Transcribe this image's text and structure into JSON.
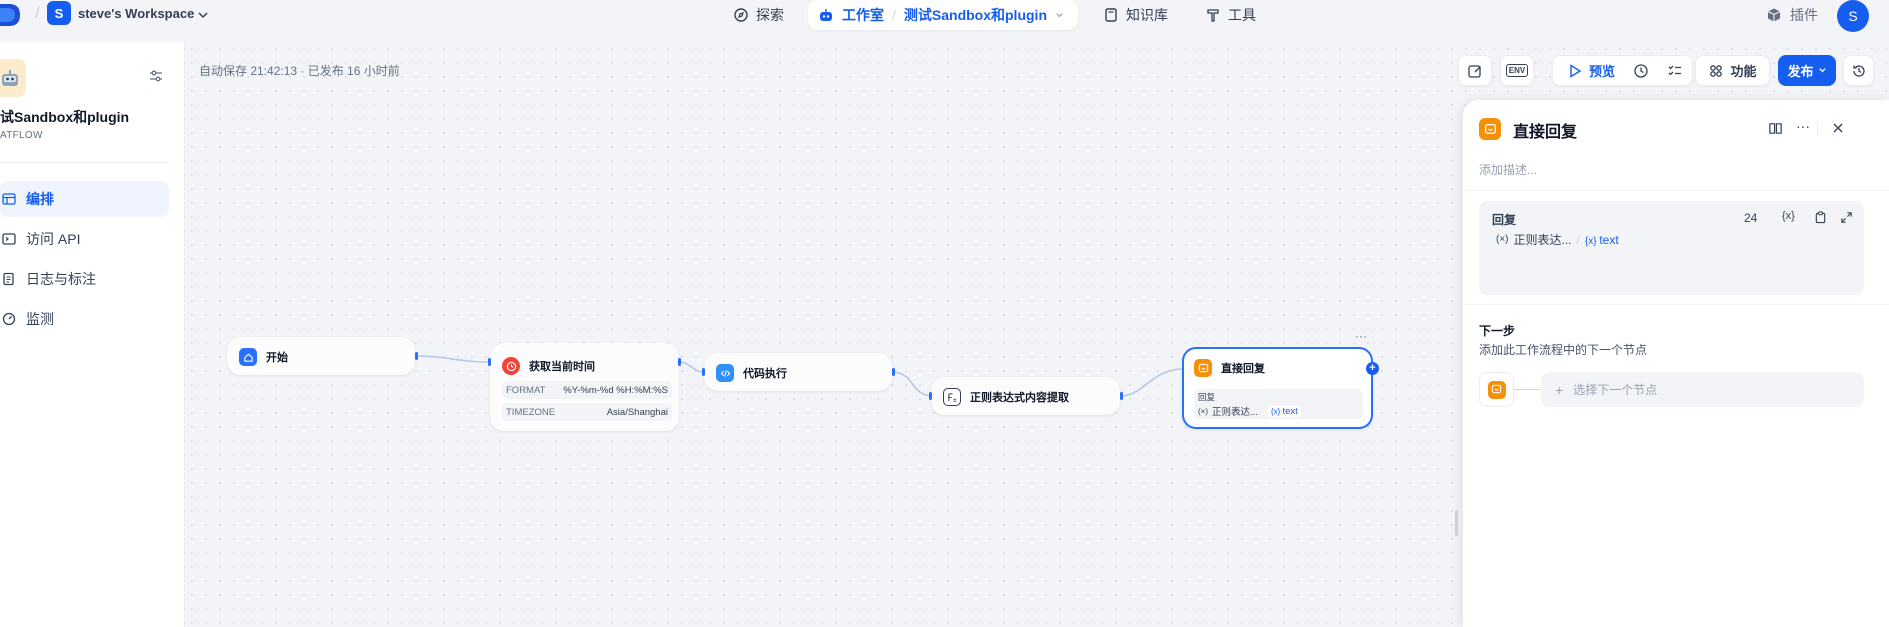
{
  "workspace": {
    "avatar_letter": "S",
    "name": "steve's Workspace"
  },
  "topnav": {
    "explore": "探索",
    "studio": "工作室",
    "app_name": "测试Sandbox和plugin",
    "knowledge": "知识库",
    "tools": "工具",
    "plugins": "插件",
    "user_initial": "S"
  },
  "sidebar": {
    "app_name": "试Sandbox和plugin",
    "app_type": "ATFLOW",
    "items": [
      {
        "label": "编排",
        "icon": "layout-icon",
        "active": true
      },
      {
        "label": "访问 API",
        "icon": "terminal-icon",
        "active": false
      },
      {
        "label": "日志与标注",
        "icon": "file-list-icon",
        "active": false
      },
      {
        "label": "监测",
        "icon": "dashboard-icon",
        "active": false
      }
    ]
  },
  "canvas": {
    "autosave": "自动保存 21:42:13 · 已发布 16 小时前"
  },
  "toolbar": {
    "env_label": "ENV",
    "preview": "预览",
    "features": "功能",
    "publish": "发布"
  },
  "nodes": {
    "start": {
      "title": "开始",
      "color": "#2970ff"
    },
    "time": {
      "title": "获取当前时间",
      "color": "#f04438",
      "params": [
        {
          "key": "FORMAT",
          "value": "%Y-%m-%d %H:%M:%S"
        },
        {
          "key": "TIMEZONE",
          "value": "Asia/Shanghai"
        }
      ]
    },
    "code": {
      "title": "代码执行",
      "color": "#2e90fa"
    },
    "regex": {
      "title": "正则表达式内容提取",
      "color": "#344054"
    },
    "answer": {
      "title": "直接回复",
      "color": "#f79009",
      "reply_label": "回复",
      "var_node": "正则表达...",
      "var_name": "text"
    }
  },
  "panel": {
    "title": "直接回复",
    "description_placeholder": "添加描述...",
    "reply_label": "回复",
    "reply_count": "24",
    "var_node": "正则表达...",
    "var_name": "text",
    "next_title": "下一步",
    "next_desc": "添加此工作流程中的下一个节点",
    "next_select": "选择下一个节点"
  }
}
